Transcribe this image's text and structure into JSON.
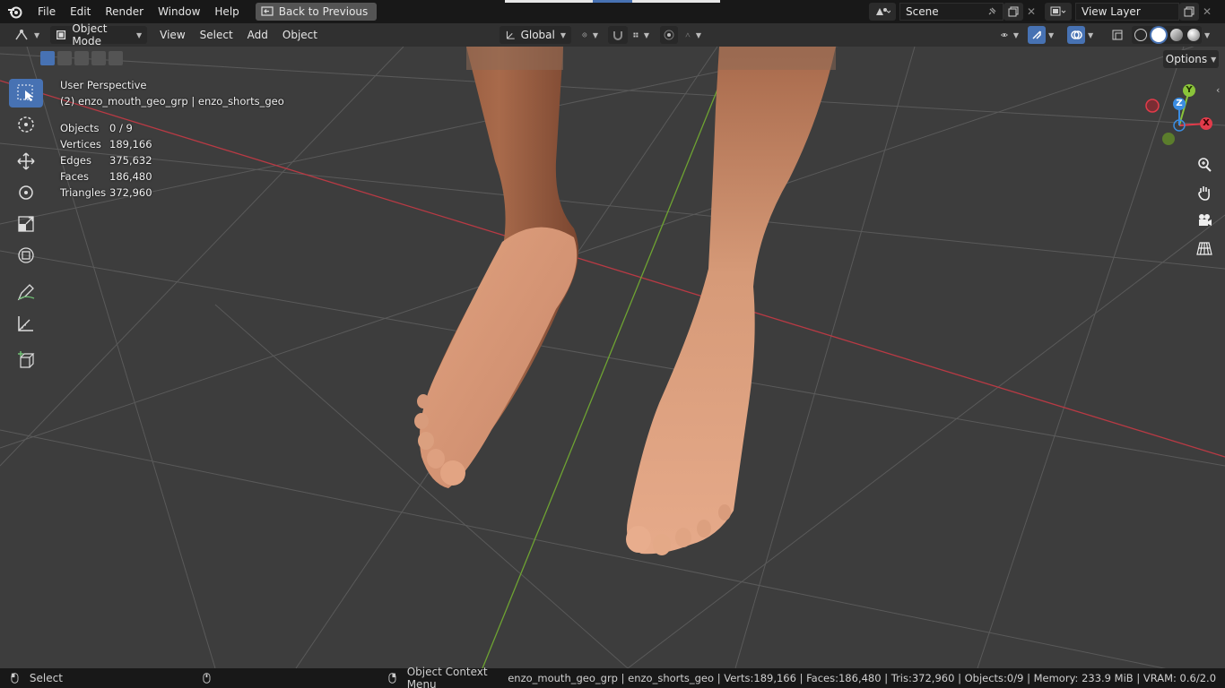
{
  "topbar": {
    "menus": [
      "File",
      "Edit",
      "Render",
      "Window",
      "Help"
    ],
    "back_button": "Back to Previous",
    "scene_name": "Scene",
    "view_layer": "View Layer"
  },
  "header": {
    "mode": "Object Mode",
    "menus": [
      "View",
      "Select",
      "Add",
      "Object"
    ],
    "orientation": "Global"
  },
  "overlay": {
    "perspective": "User Perspective",
    "active_object": "(2) enzo_mouth_geo_grp | enzo_shorts_geo",
    "stats": [
      {
        "label": "Objects",
        "value": "0 / 9"
      },
      {
        "label": "Vertices",
        "value": "189,166"
      },
      {
        "label": "Edges",
        "value": "375,632"
      },
      {
        "label": "Faces",
        "value": "186,480"
      },
      {
        "label": "Triangles",
        "value": "372,960"
      }
    ]
  },
  "options_label": "Options",
  "gizmo": {
    "x": "X",
    "y": "Y",
    "z": "Z"
  },
  "statusbar": {
    "left_action": "Select",
    "mid_action": "Object Context Menu",
    "info": "enzo_mouth_geo_grp | enzo_shorts_geo | Verts:189,166 | Faces:186,480 | Tris:372,960 | Objects:0/9 | Memory: 233.9 MiB | VRAM: 0.6/2.0"
  },
  "colors": {
    "accent": "#4772b3",
    "x_axis": "#e23b4a",
    "y_axis": "#8ac43a",
    "z_axis": "#3b8de2",
    "skin": "#d99a78"
  }
}
